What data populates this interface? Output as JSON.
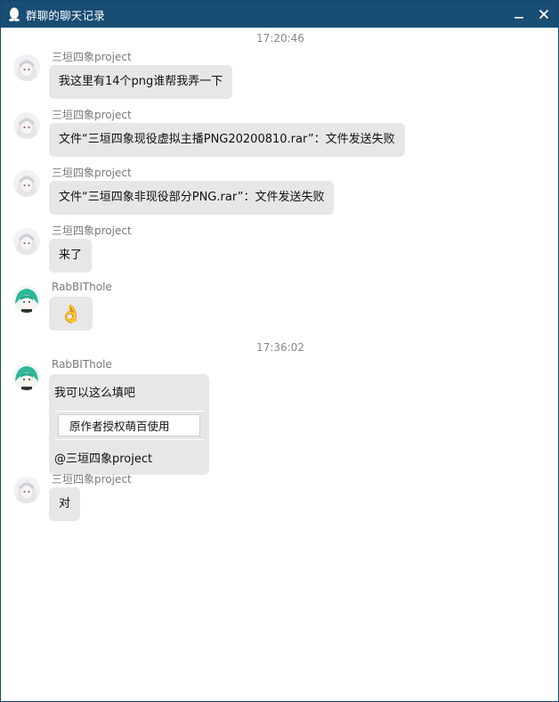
{
  "window": {
    "title": "群聊的聊天记录",
    "colors": {
      "titlebar": "#184d74",
      "bubble": "#e7e7e7",
      "sender": "#7a7a7a"
    }
  },
  "timestamps": [
    "17:20:46",
    "17:36:02"
  ],
  "messages": [
    {
      "sender": "三垣四象project",
      "avatar": "white-hair-avatar",
      "text": "我这里有14个png谁帮我弄一下"
    },
    {
      "sender": "三垣四象project",
      "avatar": "white-hair-avatar",
      "text": "文件“三垣四象现役虚拟主播PNG20200810.rar”：文件发送失败"
    },
    {
      "sender": "三垣四象project",
      "avatar": "white-hair-avatar",
      "text": "文件“三垣四象非现役部分PNG.rar”：文件发送失败"
    },
    {
      "sender": "三垣四象project",
      "avatar": "white-hair-avatar",
      "text": "来了"
    },
    {
      "sender": "RabBIThole",
      "avatar": "green-hair-avatar",
      "emoji": "👌"
    },
    {
      "sender": "RabBIThole",
      "avatar": "green-hair-avatar",
      "line1": "我可以这么填吧",
      "quote": "原作者授权萌百使用",
      "line3": "@三垣四象project"
    },
    {
      "sender": "三垣四象project",
      "avatar": "white-hair-avatar",
      "text": "对"
    }
  ],
  "icons": {
    "logo": "penguin-icon",
    "minimize": "minimize-icon",
    "close": "close-icon"
  }
}
